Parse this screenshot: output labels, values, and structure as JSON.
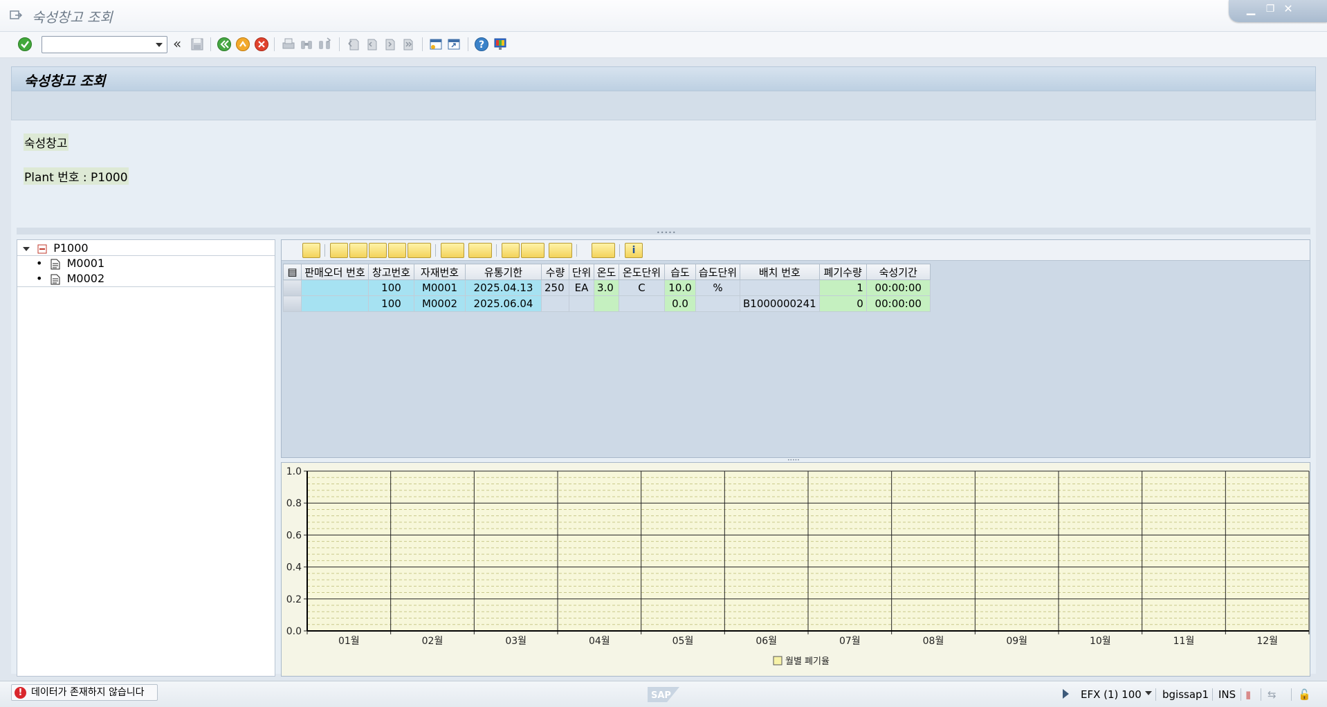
{
  "window": {
    "title": "숙성창고 조회"
  },
  "toolbar": {
    "command_value": "",
    "icons": [
      "check-icon",
      "save-icon",
      "back-icon",
      "exit-icon",
      "cancel-icon",
      "print-icon",
      "find-icon",
      "find-next-icon",
      "first-page-icon",
      "prev-page-icon",
      "next-page-icon",
      "last-page-icon",
      "new-session-icon",
      "shortcut-icon",
      "help-icon",
      "customize-layout-icon"
    ]
  },
  "page": {
    "header": "숙성창고 조회",
    "label_warehouse": "숙성창고",
    "label_plant": "Plant 번호 : P1000"
  },
  "tree": {
    "root": "P1000",
    "children": [
      "M0001",
      "M0002"
    ]
  },
  "grid": {
    "columns": [
      "판매오더 번호",
      "창고번호",
      "자재번호",
      "유통기한",
      "수량",
      "단위",
      "온도",
      "온도단위",
      "습도",
      "습도단위",
      "배치 번호",
      "폐기수량",
      "숙성기간"
    ],
    "rows": [
      [
        "",
        "100",
        "M0001",
        "2025.04.13",
        "250",
        "EA",
        "3.0",
        "C",
        "10.0",
        "%",
        "",
        "1",
        "00:00:00"
      ],
      [
        "",
        "100",
        "M0002",
        "2025.06.04",
        "",
        "",
        "",
        "",
        "0.0",
        "",
        "B1000000241",
        "0",
        "00:00:00"
      ]
    ]
  },
  "chart_data": {
    "type": "bar",
    "categories": [
      "01월",
      "02월",
      "03월",
      "04월",
      "05월",
      "06월",
      "07월",
      "08월",
      "09월",
      "10월",
      "11월",
      "12월"
    ],
    "series": [
      {
        "name": "월별 폐기율",
        "values": [
          0,
          0,
          0,
          0,
          0,
          0,
          0,
          0,
          0,
          0,
          0,
          0
        ]
      }
    ],
    "yticks": [
      "0.0",
      "0.2",
      "0.4",
      "0.6",
      "0.8",
      "1.0"
    ],
    "ylim": [
      0,
      1
    ],
    "grid": true,
    "legend_position": "bottom-center",
    "title": "",
    "xlabel": "",
    "ylabel": ""
  },
  "status": {
    "message": "데이터가 존재하지 않습니다",
    "system": "EFX (1) 100",
    "server": "bgissap1",
    "mode": "INS",
    "logo": "SAP"
  },
  "colors": {
    "key_cell": "#a6e2f2",
    "value_cell": "#c5f0c0",
    "chart_bg": "#f5f5e6",
    "error": "#d9262c"
  }
}
